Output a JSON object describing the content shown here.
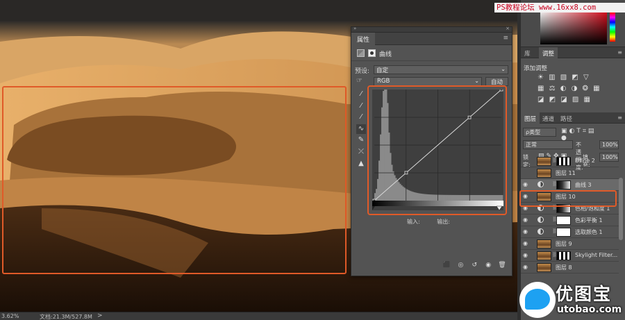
{
  "watermark": {
    "text": "PS教程论坛 www.16xx8.com"
  },
  "status_bar": {
    "zoom": "3.62%",
    "doc_info": "文档:21.3M/527.8M",
    "arrow": ">"
  },
  "properties_panel": {
    "tab": "属性",
    "adjustment_name": "曲线",
    "preset_label": "预设:",
    "preset_value": "自定",
    "channel_value": "RGB",
    "auto_label": "自动",
    "input_label": "输入:",
    "output_label": "输出:",
    "tools": [
      "target-adjust-icon",
      "black-eyedropper-icon",
      "gray-eyedropper-icon",
      "white-eyedropper-icon",
      "curve-points-icon",
      "pencil-icon",
      "smooth-icon",
      "clipping-warning-icon"
    ],
    "bottom_icons": [
      "clip-to-layer-icon",
      "view-previous-icon",
      "reset-icon",
      "visibility-icon",
      "delete-icon"
    ]
  },
  "curve": {
    "points": [
      [
        0,
        0
      ],
      [
        64,
        64
      ],
      [
        191,
        191
      ],
      [
        255,
        255
      ]
    ],
    "histogram_peak_x": 0.07,
    "colors": {
      "highlight_border": "#e05a28"
    }
  },
  "adjust_panel": {
    "tabs": [
      "库",
      "调整"
    ],
    "active_tab": "调整",
    "title": "添加调整",
    "row1": "☀ ▥ ▧ ◩ ▽",
    "row2": "▦ ⚖ ◐ ◑ ❂ ▦",
    "row3": "◪ ◩ ◪ ▨ ▦"
  },
  "layers_panel": {
    "tabs": [
      "图层",
      "通道",
      "路径"
    ],
    "active_tab": "图层",
    "filter_label": "ρ类型",
    "blend_mode": "正常",
    "opacity_label": "不透明度:",
    "opacity_value": "100%",
    "lock_label": "锁定:",
    "fill_label": "填充:",
    "fill_value": "100%",
    "layers": [
      {
        "name": "Dfine 2",
        "visible": false,
        "kind": "pixel-mask"
      },
      {
        "name": "图层 11",
        "visible": false,
        "kind": "pixel"
      },
      {
        "name": "曲线 3",
        "visible": true,
        "kind": "curves",
        "selected": true
      },
      {
        "name": "图层 10",
        "visible": true,
        "kind": "pixel"
      },
      {
        "name": "色相/饱和度 1",
        "visible": true,
        "kind": "adj-dark"
      },
      {
        "name": "色彩平衡 1",
        "visible": true,
        "kind": "adj"
      },
      {
        "name": "选取颜色 1",
        "visible": true,
        "kind": "adj"
      },
      {
        "name": "图层 9",
        "visible": true,
        "kind": "pixel"
      },
      {
        "name": "Skylight Filter...",
        "visible": true,
        "kind": "pixel-mask"
      },
      {
        "name": "图层 8",
        "visible": true,
        "kind": "pixel"
      }
    ]
  },
  "logo": {
    "brand": "优图宝",
    "url": "utobao.com"
  }
}
